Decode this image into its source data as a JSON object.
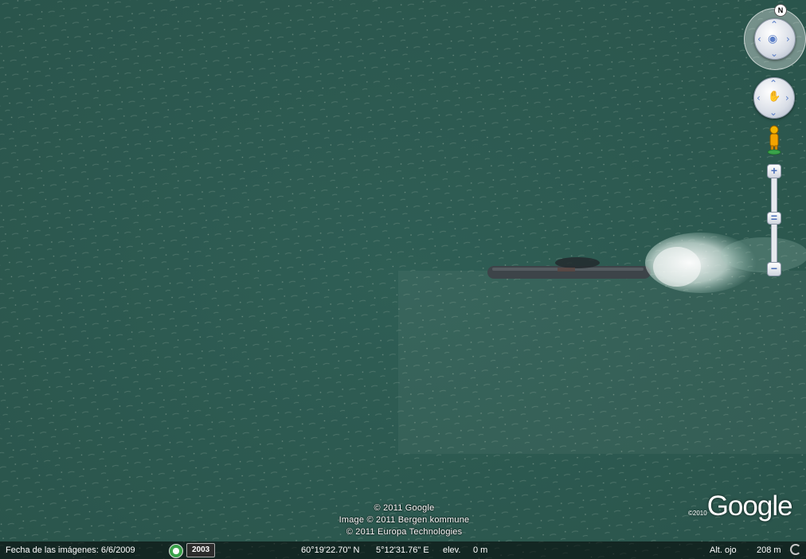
{
  "compass": {
    "north_label": "N"
  },
  "attribution": {
    "lines": [
      "© 2011 Google",
      "Image © 2011 Bergen kommune",
      "© 2011 Europa Technologies"
    ]
  },
  "logo": {
    "copyright_year": "©2010",
    "brand": "Google"
  },
  "status": {
    "imagery_date": "Fecha de las imágenes: 6/6/2009",
    "history_year": "2003",
    "latitude": "60°19'22.70\" N",
    "longitude": "5°12'31.76\" E",
    "elevation_label": "elev.",
    "elevation_value": "0 m",
    "eye_alt_label": "Alt. ojo",
    "eye_alt_value": "208 m"
  },
  "colors": {
    "water": "#2e5b52",
    "control_blue": "#5b7fc8"
  }
}
